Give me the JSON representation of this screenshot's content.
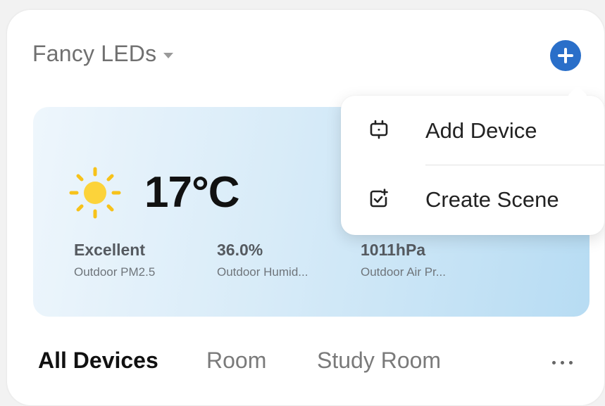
{
  "header": {
    "home_name": "Fancy LEDs",
    "add_icon": "plus-icon",
    "accent_color": "#2a6fc9"
  },
  "weather": {
    "icon": "sun-icon",
    "temperature": "17°C",
    "stats": [
      {
        "value": "Excellent",
        "label": "Outdoor PM2.5"
      },
      {
        "value": "36.0%",
        "label": "Outdoor Humid..."
      },
      {
        "value": "1011hPa",
        "label": "Outdoor Air Pr..."
      }
    ]
  },
  "tabs": [
    {
      "label": "All Devices",
      "active": true
    },
    {
      "label": "Room",
      "active": false
    },
    {
      "label": "Study Room",
      "active": false
    }
  ],
  "more_icon": "more-horizontal-icon",
  "menu": {
    "items": [
      {
        "label": "Add Device",
        "icon": "device-icon"
      },
      {
        "label": "Create Scene",
        "icon": "create-scene-icon"
      }
    ]
  }
}
